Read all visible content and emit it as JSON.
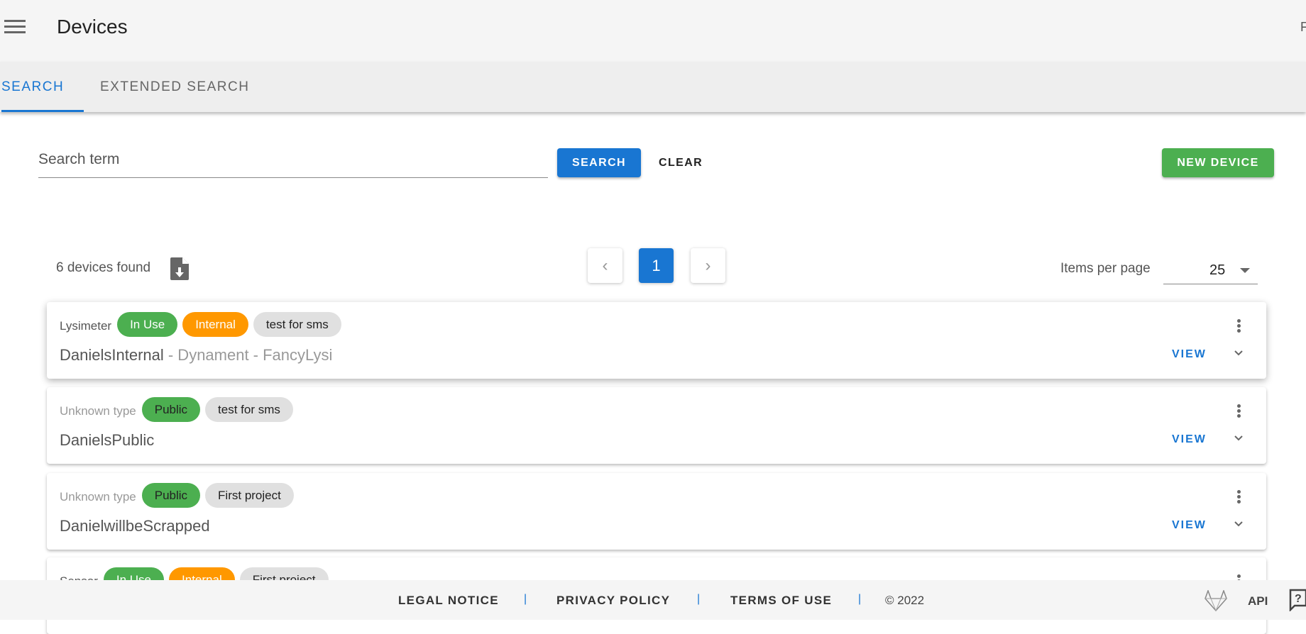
{
  "header": {
    "title": "Devices",
    "right_text": "F",
    "menu_icon": "hamburger-icon"
  },
  "tabs": [
    {
      "label": "SEARCH",
      "active": true
    },
    {
      "label": "EXTENDED SEARCH",
      "active": false
    }
  ],
  "search": {
    "placeholder": "Search term",
    "value": "",
    "search_label": "SEARCH",
    "clear_label": "CLEAR",
    "new_label": "NEW DEVICE"
  },
  "results": {
    "count_text": "6 devices found",
    "download_icon": "file-download-icon"
  },
  "pagination": {
    "prev": "‹",
    "current": "1",
    "next": "›"
  },
  "items_per_page": {
    "label": "Items per page",
    "value": "25"
  },
  "colors": {
    "primary": "#1976d2",
    "success": "#4caf50",
    "warning": "#ff9800",
    "chip": "#e0e0e0"
  },
  "devices": [
    {
      "type": "Lysimeter",
      "chips": [
        {
          "label": "In Use",
          "color": "green-white"
        },
        {
          "label": "Internal",
          "color": "orange"
        },
        {
          "label": "test for sms",
          "color": "grey"
        }
      ],
      "name": "DanielsInternal",
      "sub": " - Dynament - FancyLysi",
      "view": "VIEW"
    },
    {
      "type": "Unknown type",
      "chips": [
        {
          "label": "Public",
          "color": "green"
        },
        {
          "label": "test for sms",
          "color": "grey"
        }
      ],
      "name": "DanielsPublic",
      "sub": "",
      "view": "VIEW"
    },
    {
      "type": "Unknown type",
      "chips": [
        {
          "label": "Public",
          "color": "green"
        },
        {
          "label": "First project",
          "color": "grey"
        }
      ],
      "name": "DanielwillbeScrapped",
      "sub": "",
      "view": "VIEW"
    },
    {
      "type": "Sensor",
      "chips": [
        {
          "label": "In Use",
          "color": "green-white"
        },
        {
          "label": "Internal",
          "color": "orange"
        },
        {
          "label": "First project",
          "color": "grey"
        }
      ],
      "name": "",
      "sub": "",
      "view": ""
    }
  ],
  "footer": {
    "legal": "LEGAL NOTICE",
    "privacy": "PRIVACY POLICY",
    "terms": "TERMS OF USE",
    "sep": "|",
    "copyright": "© 2022",
    "api": "API",
    "gitlab_icon": "gitlab-icon",
    "help_icon": "help-icon"
  }
}
